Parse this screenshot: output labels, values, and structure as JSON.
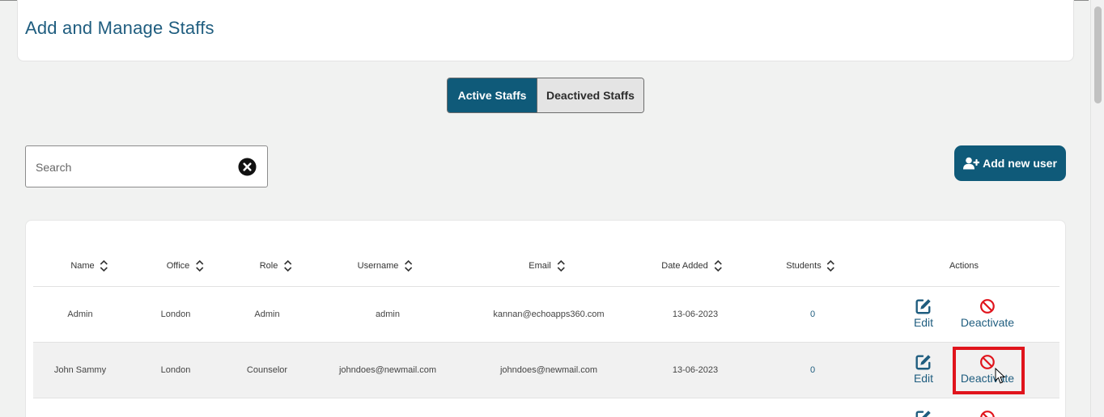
{
  "page": {
    "title": "Add and Manage Staffs"
  },
  "tabs": {
    "active_label": "Active Staffs",
    "inactive_label": "Deactived Staffs"
  },
  "search": {
    "placeholder": "Search",
    "value": ""
  },
  "add_button": {
    "label": "Add new user"
  },
  "table": {
    "columns": [
      "Name",
      "Office",
      "Role",
      "Username",
      "Email",
      "Date Added",
      "Students",
      "Actions"
    ],
    "rows": [
      {
        "name": "Admin",
        "office": "London",
        "role": "Admin",
        "username": "admin",
        "email": "kannan@echoapps360.com",
        "date_added": "13-06-2023",
        "students": "0",
        "edit": "Edit",
        "deactivate": "Deactivate"
      },
      {
        "name": "John Sammy",
        "office": "London",
        "role": "Counselor",
        "username": "johndoes@newmail.com",
        "email": "johndoes@newmail.com",
        "date_added": "13-06-2023",
        "students": "0",
        "edit": "Edit",
        "deactivate": "Deactivate"
      }
    ]
  },
  "icons": {
    "sort": "sort-icon",
    "clear": "close-circle-icon",
    "add_user": "user-plus-icon",
    "edit": "edit-icon",
    "deactivate": "ban-icon"
  },
  "colors": {
    "primary": "#0f5a79",
    "link": "#1f5d7f",
    "danger": "#e0141c",
    "background": "#f1f2f1"
  }
}
